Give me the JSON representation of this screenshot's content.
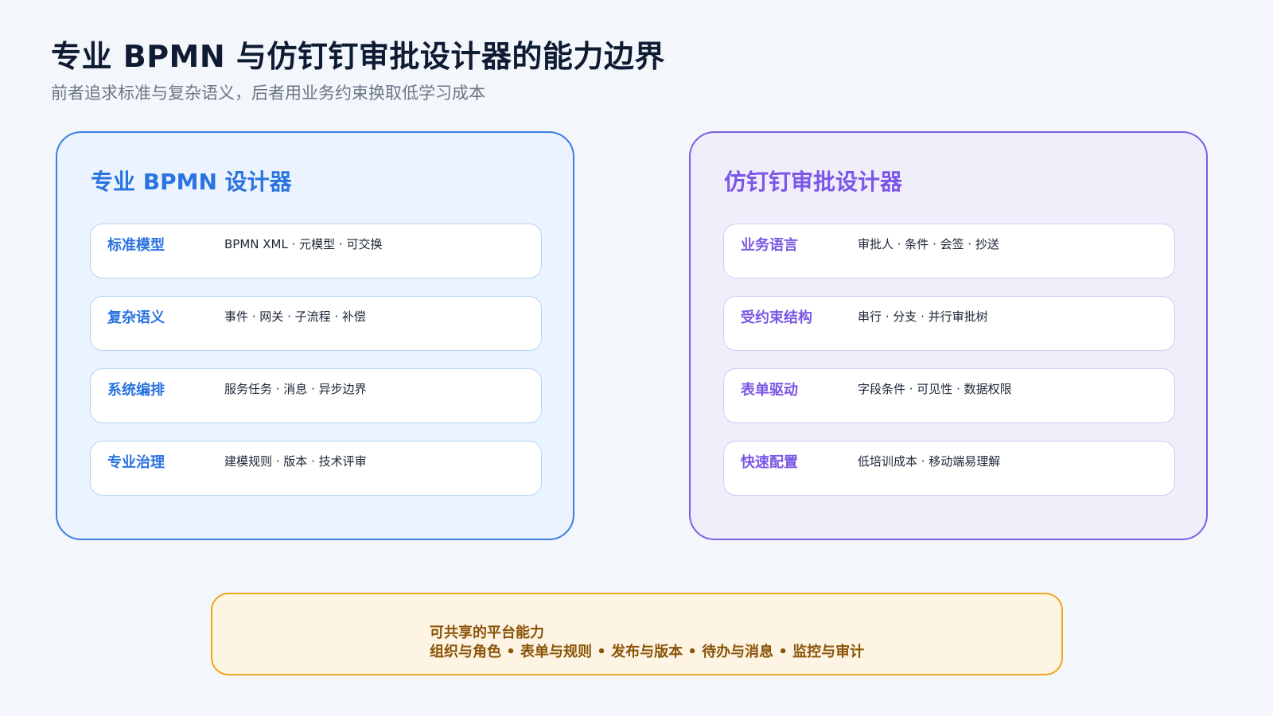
{
  "header": {
    "title": "专业 BPMN 与仿钉钉审批设计器的能力边界",
    "subtitle": "前者追求标准与复杂语义，后者用业务约束换取低学习成本"
  },
  "left_panel": {
    "title": "专业 BPMN 设计器",
    "accent_color": "#2b73e0",
    "rows": [
      {
        "label": "标准模型",
        "desc": "BPMN XML · 元模型 · 可交换"
      },
      {
        "label": "复杂语义",
        "desc": "事件 · 网关 · 子流程 · 补偿"
      },
      {
        "label": "系统编排",
        "desc": "服务任务 · 消息 · 异步边界"
      },
      {
        "label": "专业治理",
        "desc": "建模规则 · 版本 · 技术评审"
      }
    ]
  },
  "right_panel": {
    "title": "仿钉钉审批设计器",
    "accent_color": "#7b57e6",
    "rows": [
      {
        "label": "业务语言",
        "desc": "审批人 · 条件 · 会签 · 抄送"
      },
      {
        "label": "受约束结构",
        "desc": "串行 · 分支 · 并行审批树"
      },
      {
        "label": "表单驱动",
        "desc": "字段条件 · 可见性 · 数据权限"
      },
      {
        "label": "快速配置",
        "desc": "低培训成本 · 移动端易理解"
      }
    ]
  },
  "platform": {
    "title": "可共享的平台能力",
    "items": "组织与角色 • 表单与规则 • 发布与版本 • 待办与消息 • 监控与审计",
    "accent_color": "#f0a51c"
  }
}
